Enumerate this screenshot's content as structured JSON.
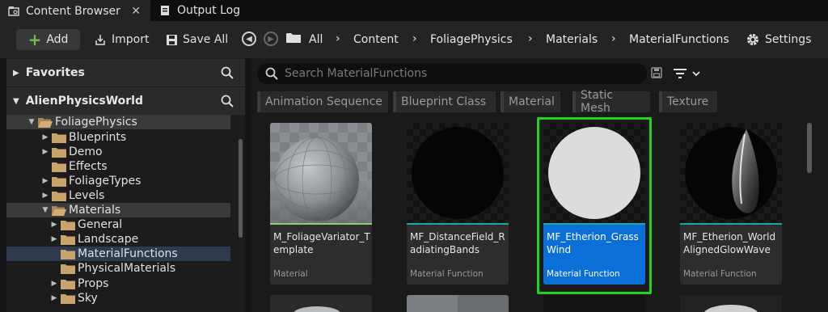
{
  "tabs": [
    {
      "label": "Content Browser",
      "close": "✕"
    },
    {
      "label": "Output Log"
    }
  ],
  "toolbar": {
    "add_label": "Add",
    "import_label": "Import",
    "save_all_label": "Save All",
    "settings_label": "Settings"
  },
  "breadcrumbs": [
    "All",
    "Content",
    "FoliagePhysics",
    "Materials",
    "MaterialFunctions"
  ],
  "breadcrumb_sep": "›",
  "left_panel": {
    "favorites": "Favorites",
    "project": "AlienPhysicsWorld",
    "tree": [
      {
        "label": "FoliagePhysics"
      },
      {
        "label": "Blueprints"
      },
      {
        "label": "Demo"
      },
      {
        "label": "Effects"
      },
      {
        "label": "FoliageTypes"
      },
      {
        "label": "Levels"
      },
      {
        "label": "Materials"
      },
      {
        "label": "General"
      },
      {
        "label": "Landscape"
      },
      {
        "label": "MaterialFunctions"
      },
      {
        "label": "PhysicalMaterials"
      },
      {
        "label": "Props"
      },
      {
        "label": "Sky"
      }
    ]
  },
  "search": {
    "placeholder": "Search MaterialFunctions"
  },
  "filters": [
    "Animation Sequence",
    "Blueprint Class",
    "Material",
    "Static Mesh",
    "Texture"
  ],
  "assets": [
    {
      "name": "M_FoliageVariator_Template",
      "type": "Material"
    },
    {
      "name": "MF_DistanceField_RadiatingBands",
      "type": "Material Function"
    },
    {
      "name": "MF_Etherion_GrassWind",
      "type": "Material Function"
    },
    {
      "name": "MF_Etherion_WorldAlignedGlowWave",
      "type": "Material Function"
    }
  ],
  "colors": {
    "accent_green": "#6cc04a",
    "selection_blue": "#0a70d8",
    "selection_frame": "#1fd31f",
    "tile_bar": "#1ea6a6",
    "folder": "#c8a36a"
  }
}
